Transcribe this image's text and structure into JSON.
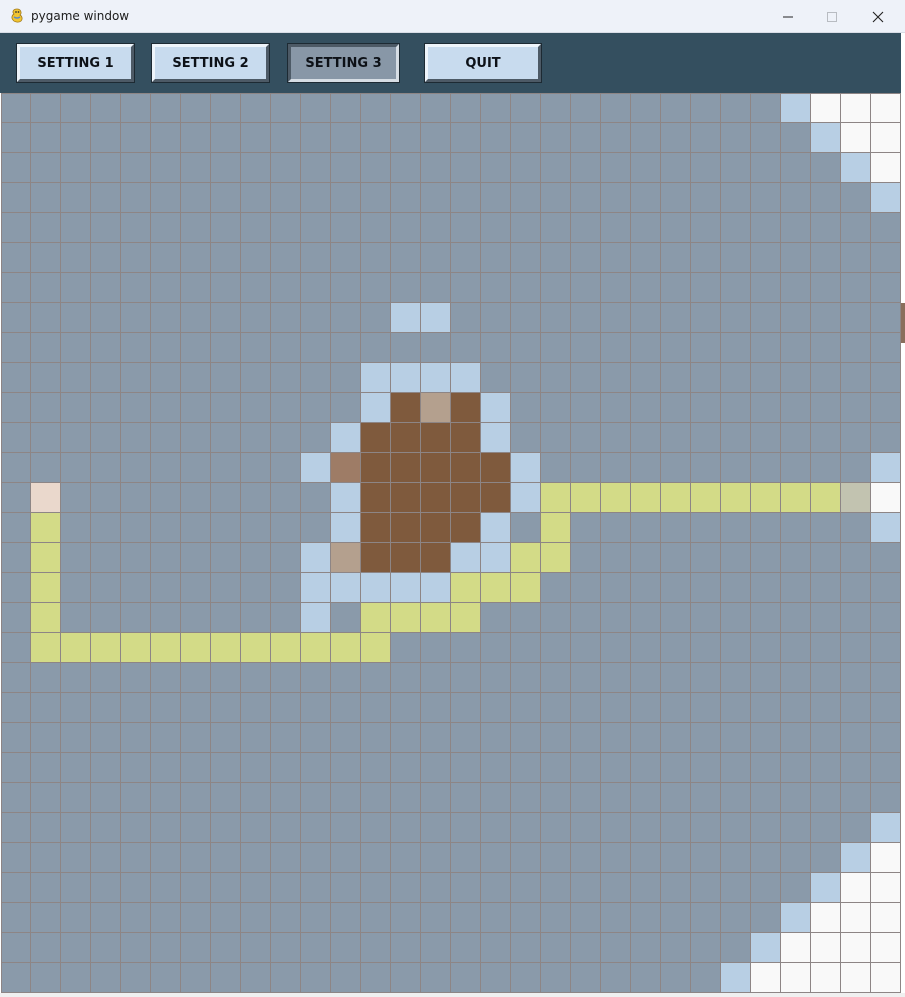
{
  "window": {
    "title": "pygame window",
    "app_icon": "pygame-snake-icon",
    "controls": {
      "minimize": "minimize-icon",
      "maximize": "maximize-icon",
      "close": "close-icon"
    }
  },
  "toolbar": {
    "buttons": [
      {
        "label": "SETTING 1",
        "pressed": false
      },
      {
        "label": "SETTING 2",
        "pressed": false
      },
      {
        "label": "SETTING 3",
        "pressed": true
      },
      {
        "label": "QUIT",
        "pressed": false
      }
    ]
  },
  "grid": {
    "cols": 30,
    "rows": 30,
    "colors": {
      ".": "#8a9aaa",
      "L": "#b8cfe4",
      "W": "#f9f9f9",
      "B": "#7f5a3d",
      "T": "#b4a08e",
      "M": "#9e7c66",
      "Y": "#d3db87",
      "P": "#ead8cc",
      "G": "#c2c3b0"
    },
    "rows_data": [
      "..........................LWWW",
      "...........................LWW",
      "............................LW",
      ".............................L",
      "..............................",
      "..............................",
      "..............................",
      ".............LL...............",
      "..............................",
      "............LLLL..............",
      "............LBTBL.............",
      "...........LBBBBL.............",
      "..........LMBBBBBL...........L",
      ".P.........LBBBBBLYYYYYYYYYYGW",
      ".Y.........LBBBBL.Y..........L",
      ".Y........LTBBBLLYY...........",
      ".Y........LLLLLYYY............",
      ".Y........L.YYYY..............",
      ".YYYYYYYYYYYY.................",
      "..............................",
      "..............................",
      "..............................",
      "..............................",
      "..............................",
      ".............................L",
      "............................LW",
      "...........................LWW",
      "..........................LWWW",
      ".........................LWWWW",
      "........................LWWWWW"
    ]
  }
}
